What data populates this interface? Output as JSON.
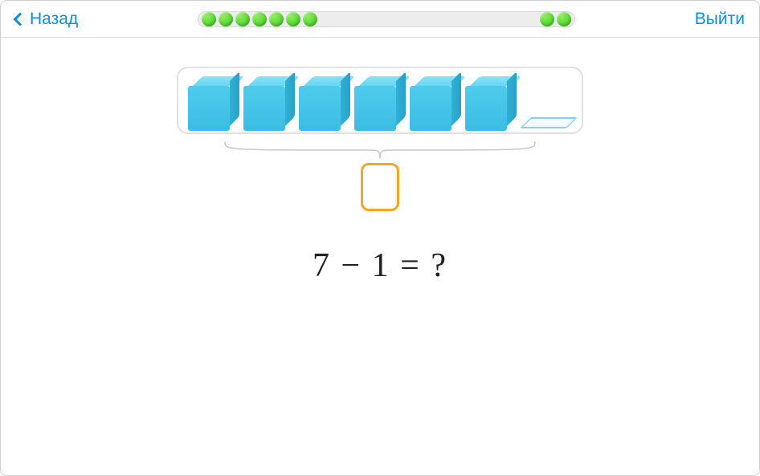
{
  "header": {
    "back_label": "Назад",
    "exit_label": "Выйти"
  },
  "progress": {
    "left_balls": 7,
    "right_balls": 2
  },
  "problem": {
    "solid_cubes": 6,
    "empty_slots": 1,
    "equation_text": "7 − 1 =  ?",
    "input_value": ""
  },
  "colors": {
    "accent": "#0d8ed9",
    "progress_ball": "#3bc41a",
    "cube": "#4ecbec",
    "input_border": "#f5a623"
  }
}
